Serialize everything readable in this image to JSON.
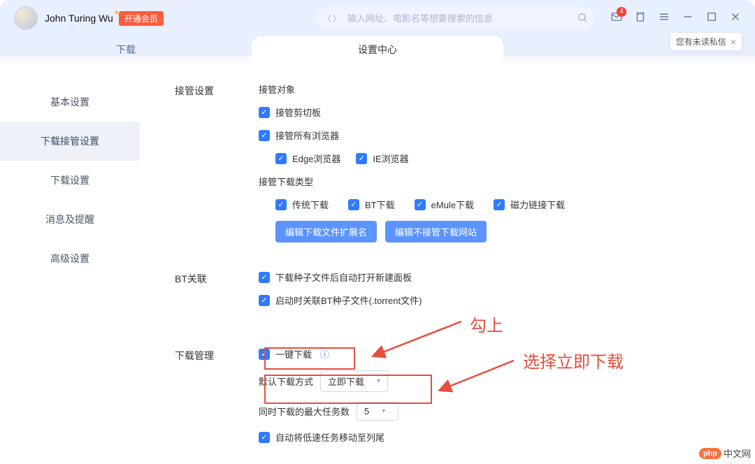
{
  "header": {
    "username": "John Turing Wu",
    "vip_label": "开通会员",
    "search_placeholder": "输入网址、电影名等想要搜索的信息",
    "mail_badge": "4",
    "toast_text": "您有未读私信"
  },
  "tabs": {
    "download": "下载",
    "settings": "设置中心"
  },
  "sidebar": {
    "items": [
      "基本设置",
      "下载接管设置",
      "下载设置",
      "消息及提醒",
      "高级设置"
    ],
    "active_index": 1
  },
  "sections": {
    "takeover": {
      "label": "接管设置",
      "target_title": "接管对象",
      "opt_clipboard": "接管剪切板",
      "opt_all_browsers": "接管所有浏览器",
      "opt_edge": "Edge浏览器",
      "opt_ie": "IE浏览器",
      "type_title": "接管下载类型",
      "opt_traditional": "传统下载",
      "opt_bt": "BT下载",
      "opt_emule": "eMule下载",
      "opt_magnet": "磁力链接下载",
      "btn_edit_ext": "编辑下载文件扩展名",
      "btn_edit_sites": "编辑不接管下载网站"
    },
    "bt": {
      "label": "BT关联",
      "opt_auto_open": "下载种子文件后自动打开新建面板",
      "opt_assoc": "启动时关联BT种子文件(.torrent文件)"
    },
    "dlmgr": {
      "label": "下载管理",
      "opt_one_click": "一键下载",
      "default_mode_label": "默认下载方式",
      "default_mode_value": "立即下载",
      "max_tasks_label": "同时下载的最大任务数",
      "max_tasks_value": "5",
      "opt_move_low": "自动将低速任务移动至列尾"
    }
  },
  "annotations": {
    "tick": "勾上",
    "choose": "选择立即下载"
  },
  "watermark": {
    "badge": "php",
    "text": "中文网"
  }
}
